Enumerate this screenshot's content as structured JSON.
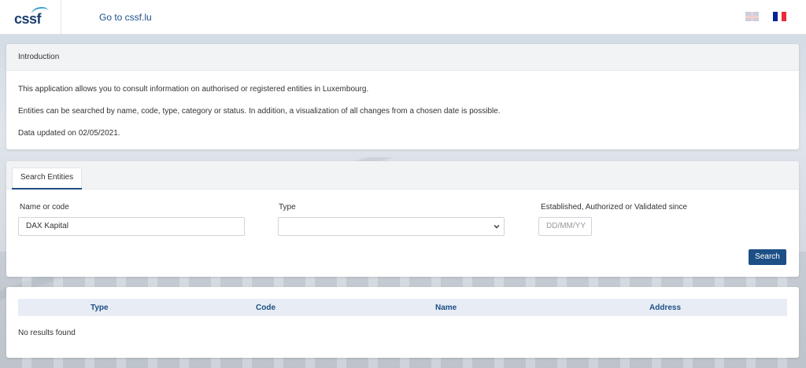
{
  "header": {
    "logo_text": "cssf",
    "link_label": "Go to cssf.lu",
    "languages": [
      {
        "name": "uk-flag-icon"
      },
      {
        "name": "fr-flag-icon"
      }
    ]
  },
  "intro": {
    "title": "Introduction",
    "paragraphs": [
      "This application allows you to consult information on authorised or registered entities in Luxembourg.",
      "Entities can be searched by name, code, type, category or status. In addition, a visualization of all changes from a chosen date is possible.",
      "Data updated on 02/05/2021."
    ]
  },
  "search": {
    "tab_label": "Search Entities",
    "name_label": "Name or code",
    "name_value": "DAX Kapital",
    "type_label": "Type",
    "type_value": "",
    "date_label": "Established, Authorized or Validated since",
    "date_placeholder": "DD/MM/YY",
    "button_label": "Search"
  },
  "results": {
    "columns": [
      "Type",
      "Code",
      "Name",
      "Address"
    ],
    "empty_text": "No results found"
  },
  "colors": {
    "primary": "#1c4f86",
    "flag_fr": [
      "#002395",
      "#ffffff",
      "#ed2939"
    ]
  }
}
